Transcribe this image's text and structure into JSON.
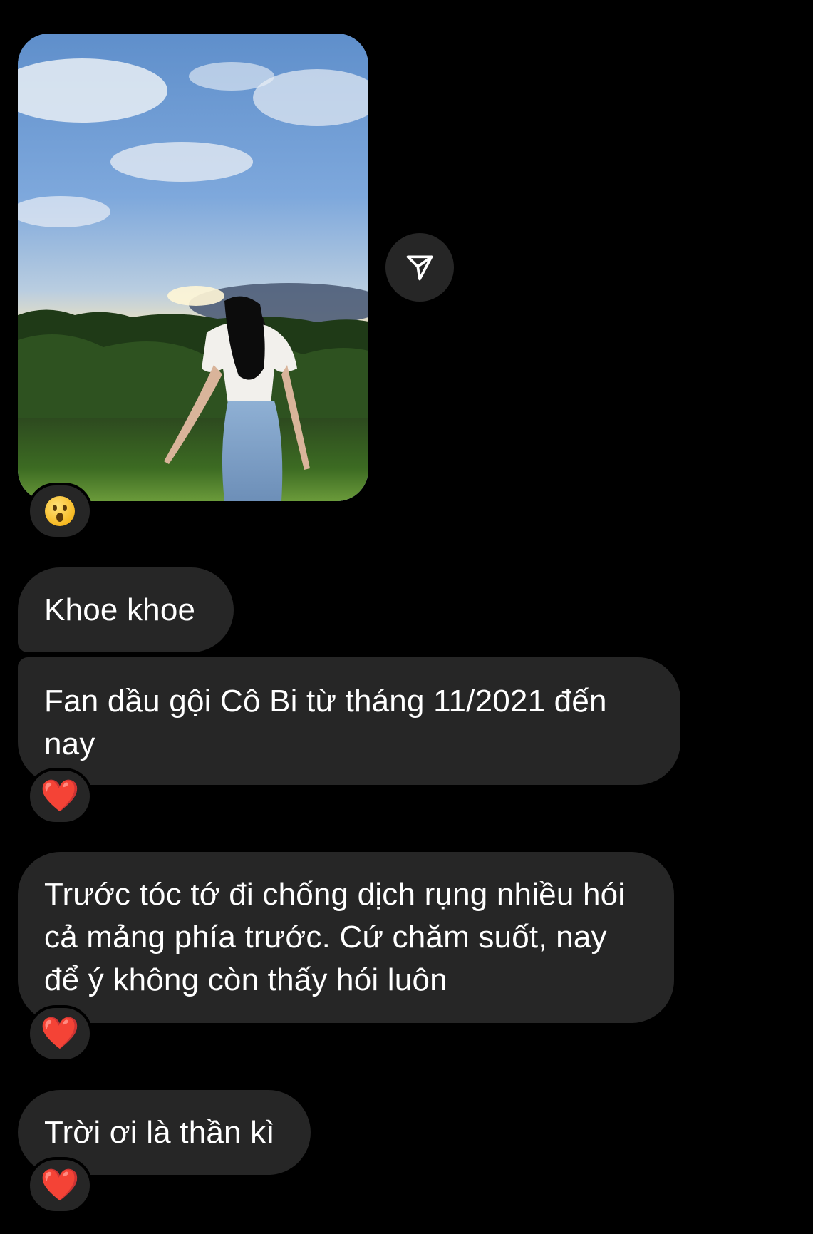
{
  "thread": {
    "photo": {
      "alt": ""
    },
    "share_icon": "paper-plane-icon",
    "messages": [
      {
        "text": "Khoe khoe",
        "reaction": null
      },
      {
        "text": "Fan dầu gội Cô Bi từ tháng 11/2021 đến nay",
        "reaction": "❤️"
      },
      {
        "text": "Trước tóc tớ đi chống dịch rụng nhiều hói cả mảng phía trước. Cứ chăm suốt, nay để ý không còn thấy hói luôn",
        "reaction": "❤️"
      },
      {
        "text": "Trời ơi là thần kì",
        "reaction": "❤️"
      }
    ],
    "photo_reaction": "😮"
  },
  "colors": {
    "background": "#000000",
    "bubble": "#262626",
    "text": "#ffffff",
    "heart": "#e3262b"
  }
}
